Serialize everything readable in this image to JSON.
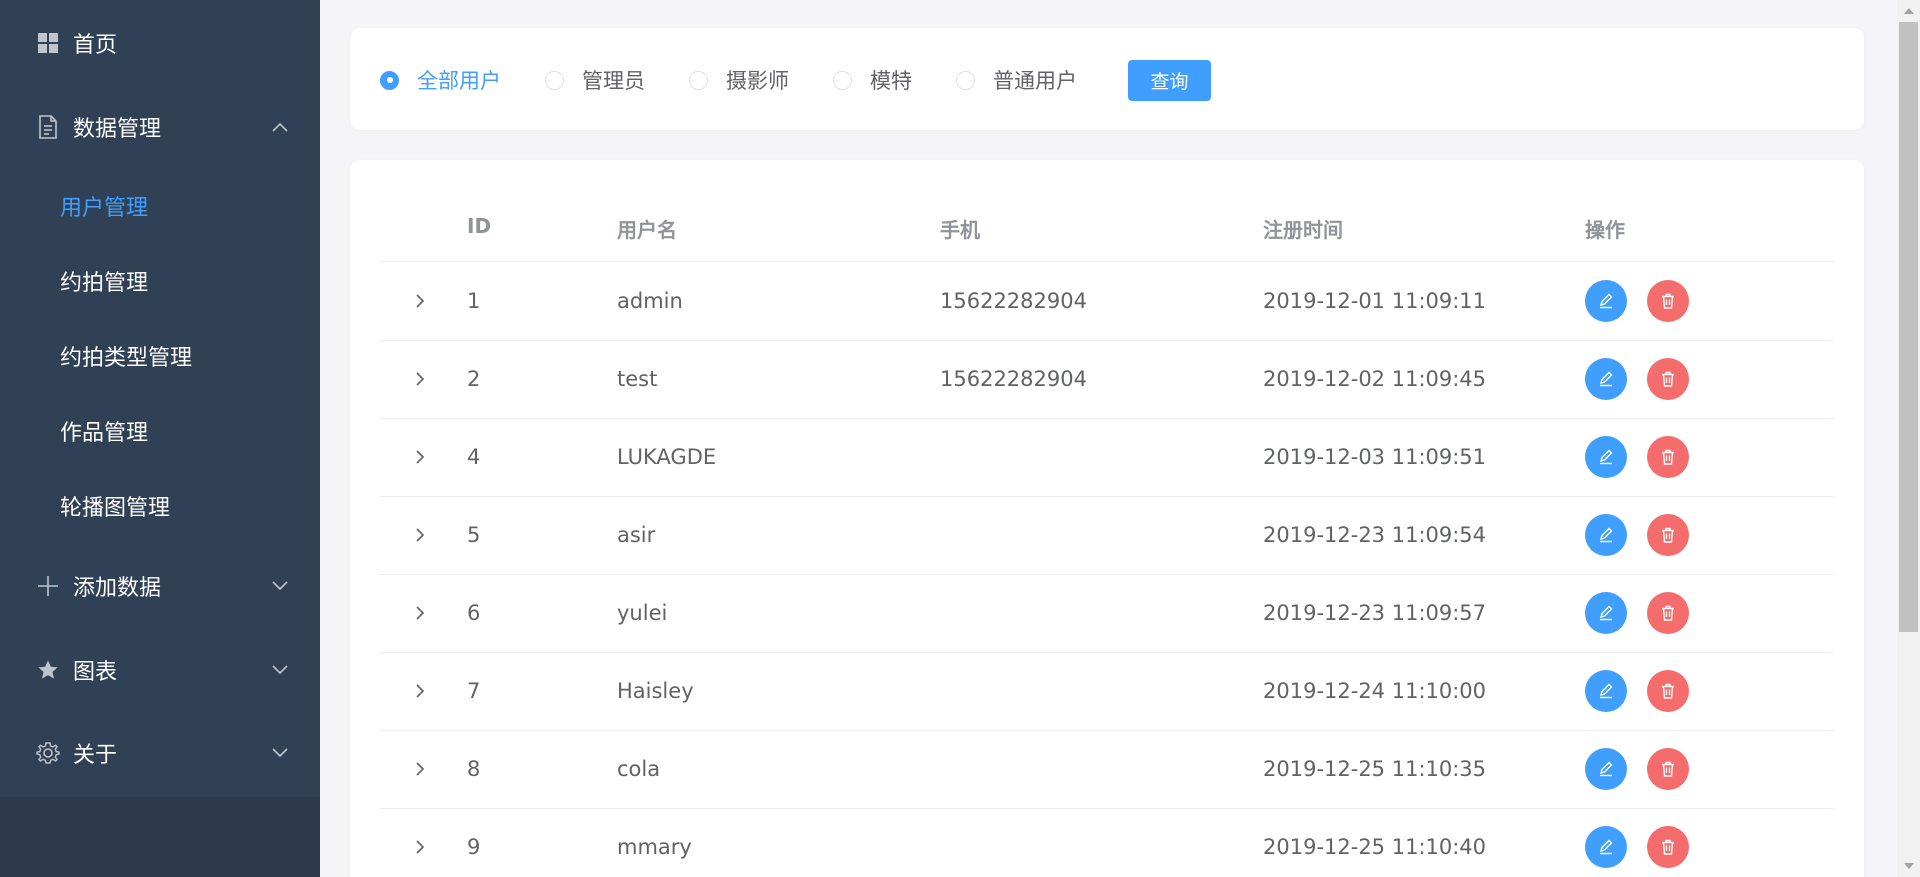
{
  "sidebar": {
    "home": {
      "label": "首页",
      "icon": "grid-icon"
    },
    "data_mgmt": {
      "label": "数据管理",
      "icon": "document-icon",
      "expanded": true,
      "items": [
        {
          "label": "用户管理",
          "active": true
        },
        {
          "label": "约拍管理"
        },
        {
          "label": "约拍类型管理"
        },
        {
          "label": "作品管理"
        },
        {
          "label": "轮播图管理"
        }
      ]
    },
    "add_data": {
      "label": "添加数据",
      "icon": "plus-icon"
    },
    "charts": {
      "label": "图表",
      "icon": "star-icon"
    },
    "about": {
      "label": "关于",
      "icon": "gear-icon"
    }
  },
  "filter": {
    "options": [
      "全部用户",
      "管理员",
      "摄影师",
      "模特",
      "普通用户"
    ],
    "selected": "全部用户",
    "query_label": "查询"
  },
  "table": {
    "headers": {
      "id": "ID",
      "username": "用户名",
      "phone": "手机",
      "register_time": "注册时间",
      "actions": "操作"
    },
    "rows": [
      {
        "id": "1",
        "username": "admin",
        "phone": "15622282904",
        "register_time": "2019-12-01 11:09:11"
      },
      {
        "id": "2",
        "username": "test",
        "phone": "15622282904",
        "register_time": "2019-12-02 11:09:45"
      },
      {
        "id": "4",
        "username": "LUKAGDE",
        "phone": "",
        "register_time": "2019-12-03 11:09:51"
      },
      {
        "id": "5",
        "username": "asir",
        "phone": "",
        "register_time": "2019-12-23 11:09:54"
      },
      {
        "id": "6",
        "username": "yulei",
        "phone": "",
        "register_time": "2019-12-23 11:09:57"
      },
      {
        "id": "7",
        "username": "Haisley",
        "phone": "",
        "register_time": "2019-12-24 11:10:00"
      },
      {
        "id": "8",
        "username": "cola",
        "phone": "",
        "register_time": "2019-12-25 11:10:35"
      },
      {
        "id": "9",
        "username": "mmary",
        "phone": "",
        "register_time": "2019-12-25 11:10:40"
      }
    ]
  },
  "colors": {
    "sidebar_bg": "#304156",
    "accent": "#409eff",
    "danger": "#f56c6c"
  }
}
